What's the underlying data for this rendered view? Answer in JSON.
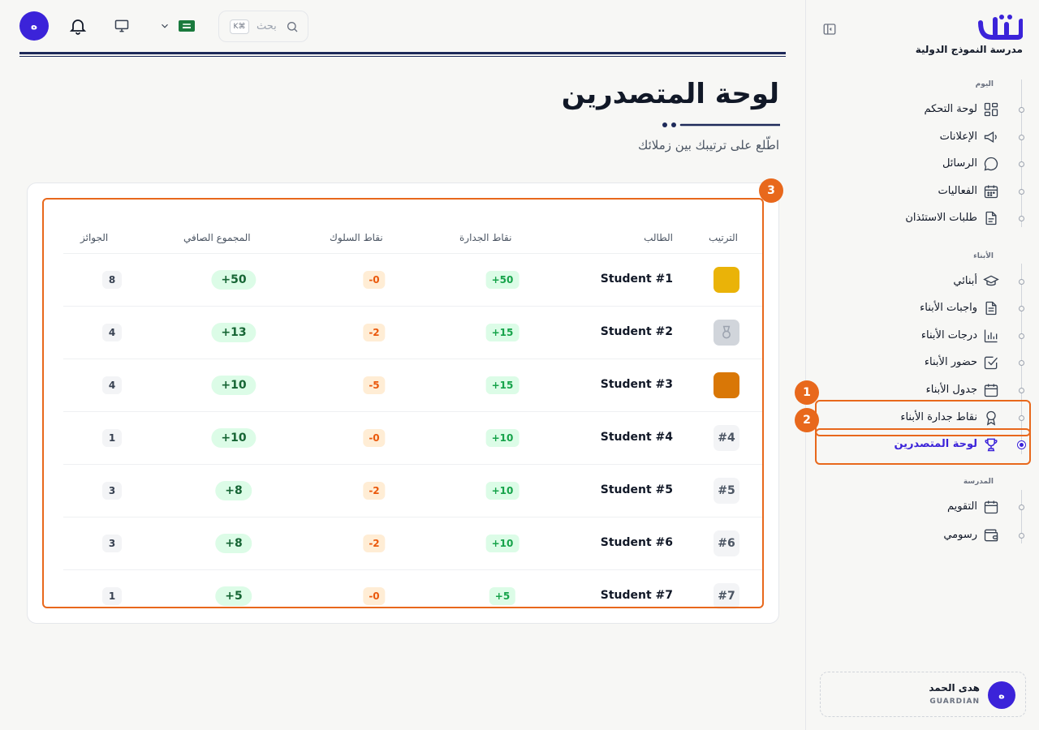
{
  "colors": {
    "accent": "#3b23d9",
    "annotation": "#e8681c",
    "merit_green": "#16a34a",
    "behavior_orange": "#ea580c"
  },
  "topbar": {
    "avatar_initial": "ه",
    "bell_icon": "bell-icon",
    "monitor_icon": "monitor-icon",
    "language_flag": "saudi-flag-icon",
    "search_placeholder": "بحث",
    "search_shortcut": "K⌘"
  },
  "sidebar": {
    "school_name": "مدرسة النموذج الدولية",
    "groups": [
      {
        "label": "اليوم",
        "items": [
          {
            "label": "لوحة التحكم",
            "icon": "dashboard-icon"
          },
          {
            "label": "الإعلانات",
            "icon": "megaphone-icon"
          },
          {
            "label": "الرسائل",
            "icon": "chat-icon"
          },
          {
            "label": "الفعاليات",
            "icon": "calendar-grid-icon"
          },
          {
            "label": "طلبات الاستئذان",
            "icon": "document-icon"
          }
        ]
      },
      {
        "label": "الأبناء",
        "items": [
          {
            "label": "أبنائي",
            "icon": "graduation-cap-icon"
          },
          {
            "label": "واجبات الأبناء",
            "icon": "homework-icon"
          },
          {
            "label": "درجات الأبناء",
            "icon": "bar-chart-icon"
          },
          {
            "label": "حضور الأبناء",
            "icon": "checkbox-icon"
          },
          {
            "label": "جدول الأبناء",
            "icon": "calendar-icon"
          },
          {
            "label": "نقاط جدارة الأبناء",
            "icon": "award-icon"
          },
          {
            "label": "لوحة المتصدرين",
            "icon": "trophy-icon",
            "active": true
          }
        ]
      },
      {
        "label": "المدرسة",
        "items": [
          {
            "label": "التقويم",
            "icon": "calendar-icon"
          },
          {
            "label": "رسومي",
            "icon": "wallet-icon"
          }
        ]
      }
    ],
    "user": {
      "initial": "ه",
      "name": "هدى الحمد",
      "role": "GUARDIAN"
    }
  },
  "page": {
    "title": "لوحة المتصدرين",
    "subtitle": "اطّلع على ترتيبك بين زملائك"
  },
  "leaderboard": {
    "columns": {
      "rank": "الترتيب",
      "student": "الطالب",
      "merit": "نقاط الجدارة",
      "behavior": "نقاط السلوك",
      "net": "المجموع الصافي",
      "awards": "الجوائز"
    },
    "rows": [
      {
        "rank": "",
        "rank_style": "gold",
        "student": "Student #1",
        "merit": "+50",
        "behavior": "-0",
        "net": "+50",
        "awards": "8"
      },
      {
        "rank": "",
        "rank_style": "silver",
        "student": "Student #2",
        "merit": "+15",
        "behavior": "-2",
        "net": "+13",
        "awards": "4"
      },
      {
        "rank": "",
        "rank_style": "bronze",
        "student": "Student #3",
        "merit": "+15",
        "behavior": "-5",
        "net": "+10",
        "awards": "4"
      },
      {
        "rank": "#4",
        "rank_style": "plain",
        "student": "Student #4",
        "merit": "+10",
        "behavior": "-0",
        "net": "+10",
        "awards": "1"
      },
      {
        "rank": "#5",
        "rank_style": "plain",
        "student": "Student #5",
        "merit": "+10",
        "behavior": "-2",
        "net": "+8",
        "awards": "3"
      },
      {
        "rank": "#6",
        "rank_style": "plain",
        "student": "Student #6",
        "merit": "+10",
        "behavior": "-2",
        "net": "+8",
        "awards": "3"
      },
      {
        "rank": "#7",
        "rank_style": "plain",
        "student": "Student #7",
        "merit": "+5",
        "behavior": "-0",
        "net": "+5",
        "awards": "1"
      }
    ]
  },
  "annotations": [
    "1",
    "2",
    "3"
  ]
}
